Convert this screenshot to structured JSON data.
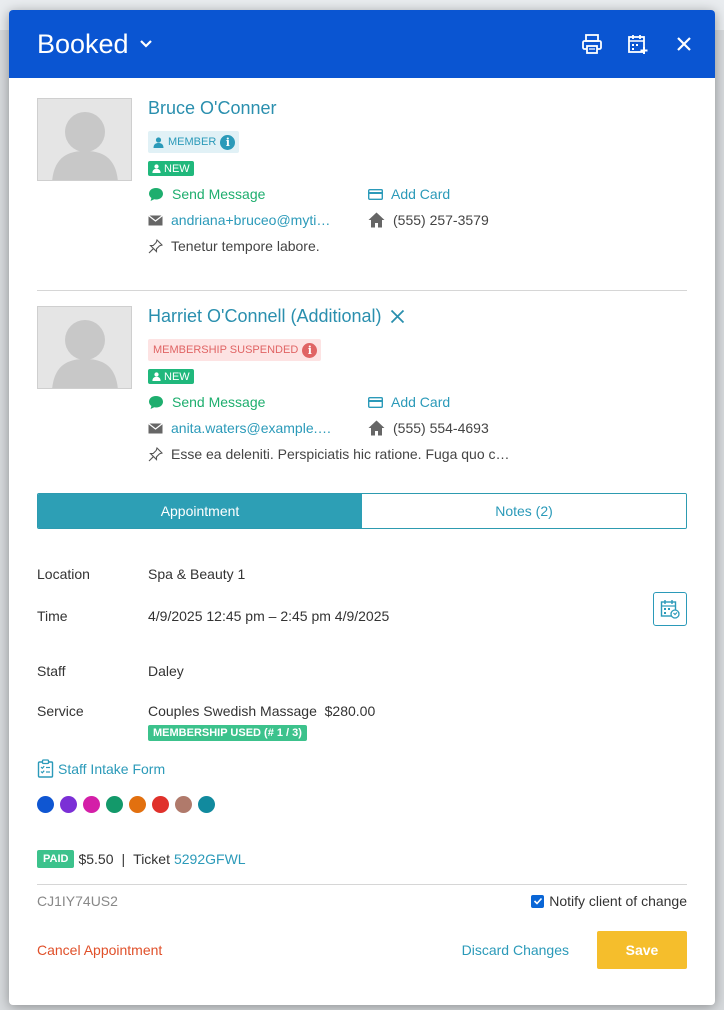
{
  "header": {
    "title": "Booked"
  },
  "clients": [
    {
      "name": "Bruce O'Conner",
      "badge": "MEMBER",
      "new_label": "NEW",
      "send_message": "Send Message",
      "add_card": "Add Card",
      "email": "andriana+bruceo@myti…",
      "phone": "(555) 257-3579",
      "note": "Tenetur tempore labore."
    },
    {
      "name": "Harriet O'Connell (Additional)",
      "badge": "MEMBERSHIP SUSPENDED",
      "new_label": "NEW",
      "send_message": "Send Message",
      "add_card": "Add Card",
      "email": "anita.waters@example.…",
      "phone": "(555) 554-4693",
      "note": "Esse ea deleniti. Perspiciatis hic ratione. Fuga quo c…"
    }
  ],
  "tabs": [
    {
      "label": "Appointment",
      "active": true
    },
    {
      "label": "Notes (2)",
      "active": false
    }
  ],
  "details": {
    "location_label": "Location",
    "location_value": "Spa & Beauty 1",
    "time_label": "Time",
    "time_value": "4/9/2025 12:45 pm – 2:45 pm 4/9/2025",
    "staff_label": "Staff",
    "staff_value": "Daley",
    "service_label": "Service",
    "service_value": "Couples Swedish Massage  $280.00",
    "membership_used": "MEMBERSHIP USED (# 1 / 3)"
  },
  "intake_form": "Staff Intake Form",
  "colors": [
    "#0f56d2",
    "#7b2fd6",
    "#d41fa8",
    "#13996a",
    "#e2700f",
    "#e0312b",
    "#b07a6b",
    "#118a9e"
  ],
  "payment": {
    "paid_label": "PAID",
    "amount": "$5.50",
    "separator": "|",
    "ticket_label": "Ticket",
    "ticket_id": "5292GFWL"
  },
  "footer": {
    "confirmation_code": "CJ1IY74US2",
    "notify_label": "Notify client of change",
    "notify_checked": true,
    "cancel_label": "Cancel Appointment",
    "discard_label": "Discard Changes",
    "save_label": "Save"
  }
}
